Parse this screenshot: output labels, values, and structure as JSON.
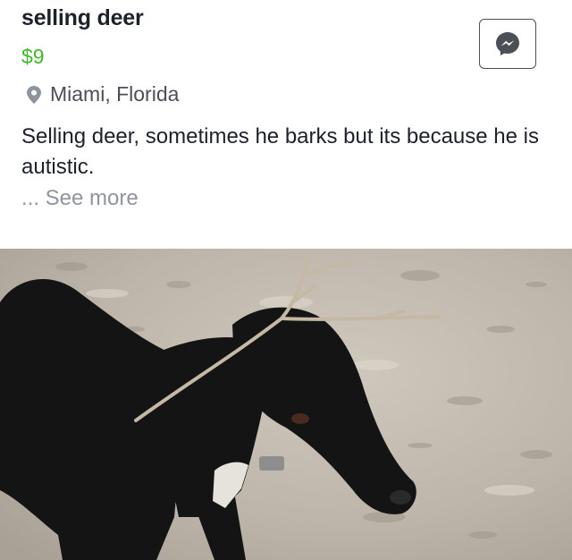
{
  "listing": {
    "title": "selling deer",
    "price": "$9",
    "location": "Miami, Florida",
    "description": "Selling deer, sometimes he barks but its because he is autistic.",
    "see_more": "... See more"
  },
  "icons": {
    "location": "location-pin-icon",
    "messenger": "messenger-icon"
  },
  "colors": {
    "price": "#42b72a",
    "text": "#1d2129",
    "muted": "#90949c"
  }
}
